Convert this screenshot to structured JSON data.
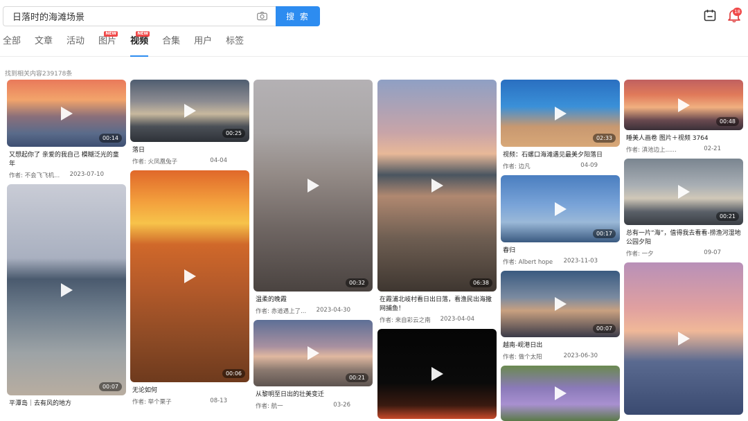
{
  "search": {
    "value": "日落时的海滩场景",
    "button_label": "搜 索"
  },
  "header": {
    "notification_count": "18"
  },
  "tabs": [
    {
      "label": "全部",
      "badge": ""
    },
    {
      "label": "文章",
      "badge": ""
    },
    {
      "label": "活动",
      "badge": ""
    },
    {
      "label": "图片",
      "badge": "NEW"
    },
    {
      "label": "视频",
      "badge": "NEW"
    },
    {
      "label": "合集",
      "badge": ""
    },
    {
      "label": "用户",
      "badge": ""
    },
    {
      "label": "标签",
      "badge": ""
    }
  ],
  "active_tab": "视频",
  "result_count": "找到相关内容239178条",
  "accent_color": "#2d8cf0",
  "columns": [
    [
      {
        "title": "又想起你了 亲爱的我自己 模糊泛光的童年",
        "author": "作者: 不会飞飞机...",
        "date": "2023-07-10",
        "duration": "00:14"
      },
      {
        "title": "平潭岛｜去有风的地方",
        "author": "",
        "date": "",
        "duration": "00:07"
      }
    ],
    [
      {
        "title": "落日",
        "author": "作者: 火凤凰兔子",
        "date": "04-04",
        "duration": "00:25"
      },
      {
        "title": "无论如何",
        "author": "作者: 举个栗子",
        "date": "08-13",
        "duration": "00:06"
      }
    ],
    [
      {
        "title": "温柔的晚霞",
        "author": "作者: 赤道遇上了...",
        "date": "2023-04-30",
        "duration": "00:32"
      },
      {
        "title": "从黎明至日出的壮美变迁",
        "author": "作者: 航一",
        "date": "03-26",
        "duration": "00:21"
      }
    ],
    [
      {
        "title": "在霞浦北岐村看日出日落，看渔民出海撒网捕鱼！",
        "author": "作者: 来自彩云之南",
        "date": "2023-04-04",
        "duration": "06:38"
      },
      {
        "title": "",
        "author": "",
        "date": "",
        "duration": ""
      }
    ],
    [
      {
        "title": "视频：石螺口海滩遇见最美夕阳落日",
        "author": "作者: 边凡",
        "date": "04-09",
        "duration": "02:33"
      },
      {
        "title": "春归",
        "author": "作者: Albert hope",
        "date": "2023-11-03",
        "duration": "00:17"
      },
      {
        "title": "越南-岘港日出",
        "author": "作者: 做个太阳",
        "date": "2023-06-30",
        "duration": "00:07"
      },
      {
        "title": "",
        "author": "",
        "date": "",
        "duration": ""
      }
    ],
    [
      {
        "title": "睡美人画卷 图片＋视频 3764",
        "author": "作者: 滇池边上......",
        "date": "02-21",
        "duration": "00:48"
      },
      {
        "title": "总有一片“海”，值得我去看看-捞渔河湿地公园夕阳",
        "author": "作者: 一夕",
        "date": "09-07",
        "duration": "00:21"
      },
      {
        "title": "",
        "author": "",
        "date": "",
        "duration": ""
      }
    ]
  ]
}
